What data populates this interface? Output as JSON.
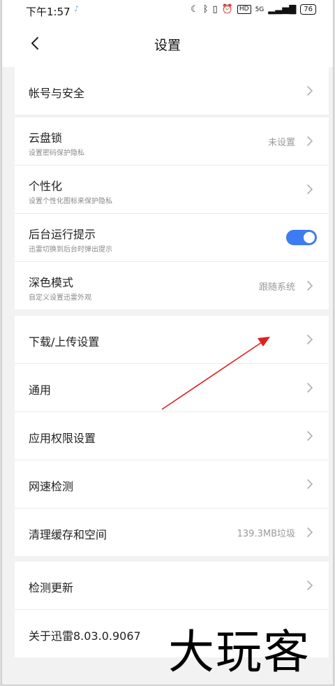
{
  "status_bar": {
    "time": "下午1:57",
    "note_icon": "music-note",
    "network": "5G",
    "hd": "HD",
    "battery": "76"
  },
  "nav": {
    "title": "设置",
    "back_icon": "chevron-left-icon"
  },
  "groups": [
    {
      "items": [
        {
          "title": "帐号与安全"
        }
      ]
    },
    {
      "items": [
        {
          "title": "云盘锁",
          "subtitle": "设置密码保护隐私",
          "value": "未设置"
        },
        {
          "title": "个性化",
          "subtitle": "设置个性化图标来保护隐私"
        },
        {
          "title": "后台运行提示",
          "subtitle": "迅雷切换到后台时弹出提示",
          "toggle": true
        },
        {
          "title": "深色模式",
          "subtitle": "自定义设置迅雷外观",
          "value": "跟随系统"
        }
      ]
    },
    {
      "items": [
        {
          "title": "下载/上传设置"
        },
        {
          "title": "通用"
        },
        {
          "title": "应用权限设置"
        },
        {
          "title": "网速检测"
        },
        {
          "title": "清理缓存和空间",
          "value": "139.3MB垃圾"
        }
      ]
    },
    {
      "items": [
        {
          "title": "检测更新"
        },
        {
          "title": "关于迅雷8.03.0.9067"
        }
      ]
    }
  ],
  "colors": {
    "toggle_on": "#3d7bf0",
    "annotation_arrow": "#e02020"
  },
  "watermark": "大玩客"
}
